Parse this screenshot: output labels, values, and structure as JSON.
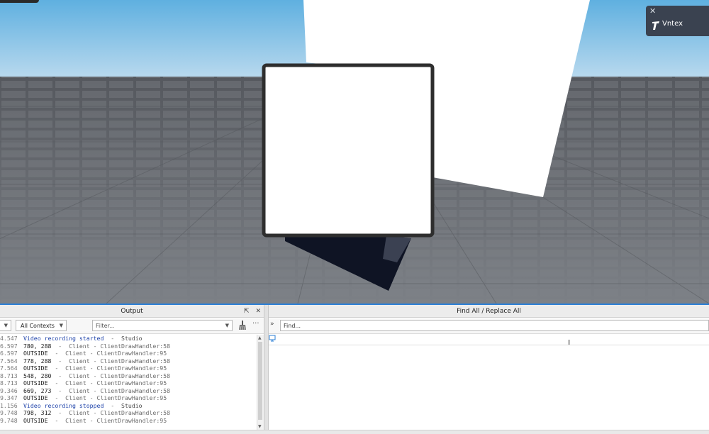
{
  "toast": {
    "app_name": "Vntex"
  },
  "output": {
    "title": "Output",
    "contexts_label": "All Contexts",
    "filter_placeholder": "Filter...",
    "more_label": "···",
    "lines": [
      {
        "time": "4.547",
        "msg": "Video recording started",
        "sep": "-",
        "src": "Studio",
        "kind": "info"
      },
      {
        "time": "6.597",
        "msg": "780, 288",
        "sep": "-",
        "src": "Client - ClientDrawHandler:58",
        "kind": "normal"
      },
      {
        "time": "6.597",
        "msg": "OUTSIDE",
        "sep": "-",
        "src": "Client - ClientDrawHandler:95",
        "kind": "normal"
      },
      {
        "time": "7.564",
        "msg": "778, 288",
        "sep": "-",
        "src": "Client - ClientDrawHandler:58",
        "kind": "normal"
      },
      {
        "time": "7.564",
        "msg": "OUTSIDE",
        "sep": "-",
        "src": "Client - ClientDrawHandler:95",
        "kind": "normal"
      },
      {
        "time": "8.713",
        "msg": "548, 280",
        "sep": "-",
        "src": "Client - ClientDrawHandler:58",
        "kind": "normal"
      },
      {
        "time": "8.713",
        "msg": "OUTSIDE",
        "sep": "-",
        "src": "Client - ClientDrawHandler:95",
        "kind": "normal"
      },
      {
        "time": "9.346",
        "msg": "669, 273",
        "sep": "-",
        "src": "Client - ClientDrawHandler:58",
        "kind": "normal"
      },
      {
        "time": "9.347",
        "msg": "OUTSIDE",
        "sep": "-",
        "src": "Client - ClientDrawHandler:95",
        "kind": "normal"
      },
      {
        "time": "1.156",
        "msg": "Video recording stopped",
        "sep": "-",
        "src": "Studio",
        "kind": "info"
      },
      {
        "time": "9.748",
        "msg": "798, 312",
        "sep": "-",
        "src": "Client - ClientDrawHandler:58",
        "kind": "normal"
      },
      {
        "time": "9.748",
        "msg": "OUTSIDE",
        "sep": "-",
        "src": "Client - ClientDrawHandler:95",
        "kind": "normal"
      }
    ]
  },
  "find": {
    "title": "Find All / Replace All",
    "placeholder": "Find..."
  },
  "icons": [
    "close-icon",
    "vntex-logo-icon",
    "undock-icon",
    "clear-output-icon",
    "expand-replace-icon",
    "monitor-icon",
    "text-cursor-icon"
  ],
  "colors": {
    "accent": "#2b7fd6",
    "info_text": "#1a3fa8",
    "sky_top": "#5fb0e0",
    "baseplate": "#6a6d72"
  }
}
